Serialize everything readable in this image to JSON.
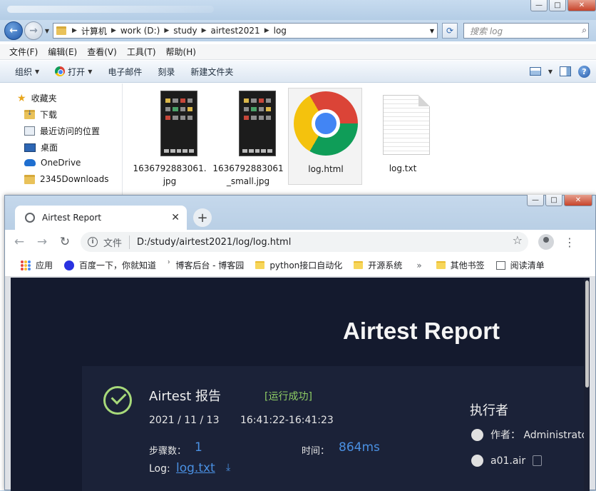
{
  "explorer": {
    "address": [
      "计算机",
      "work (D:)",
      "study",
      "airtest2021",
      "log"
    ],
    "search_placeholder": "搜索 log",
    "menu": [
      "文件(F)",
      "编辑(E)",
      "查看(V)",
      "工具(T)",
      "帮助(H)"
    ],
    "toolbar": {
      "organize": "组织",
      "open": "打开",
      "email": "电子邮件",
      "burn": "刻录",
      "new_folder": "新建文件夹"
    },
    "nav": {
      "favorites": "收藏夹",
      "items": [
        "下载",
        "最近访问的位置",
        "桌面",
        "OneDrive",
        "2345Downloads"
      ]
    },
    "files": [
      {
        "name": "1636792883061.jpg",
        "icon": "image-thumbnail"
      },
      {
        "name": "1636792883061_small.jpg",
        "icon": "image-thumbnail"
      },
      {
        "name": "log.html",
        "icon": "chrome-icon"
      },
      {
        "name": "log.txt",
        "icon": "text-file-icon"
      }
    ]
  },
  "browser": {
    "tab_title": "Airtest Report",
    "url_scheme_label": "文件",
    "url": "D:/study/airtest2021/log/log.html",
    "bookmarks": [
      "应用",
      "百度一下，你就知道",
      "博客后台 - 博客园",
      "python接口自动化",
      "开源系统",
      "其他书签",
      "阅读清单"
    ],
    "bookmarks_overflow": "»"
  },
  "report": {
    "title": "Airtest Report",
    "heading": "Airtest 报告",
    "status": "[运行成功]",
    "date": "2021 / 11 / 13",
    "time_range": "16:41:22-16:41:23",
    "steps_label": "步骤数：",
    "steps": "1",
    "duration_label": "时间：",
    "duration": "864ms",
    "log_label": "Log:",
    "log_link": "log.txt",
    "executor_heading": "执行者",
    "author": "作者： Administrator",
    "script": "a01.air"
  },
  "colors": {
    "report_bg": "#141a2e",
    "accent_link": "#4a90e2",
    "success": "#8fce65"
  }
}
